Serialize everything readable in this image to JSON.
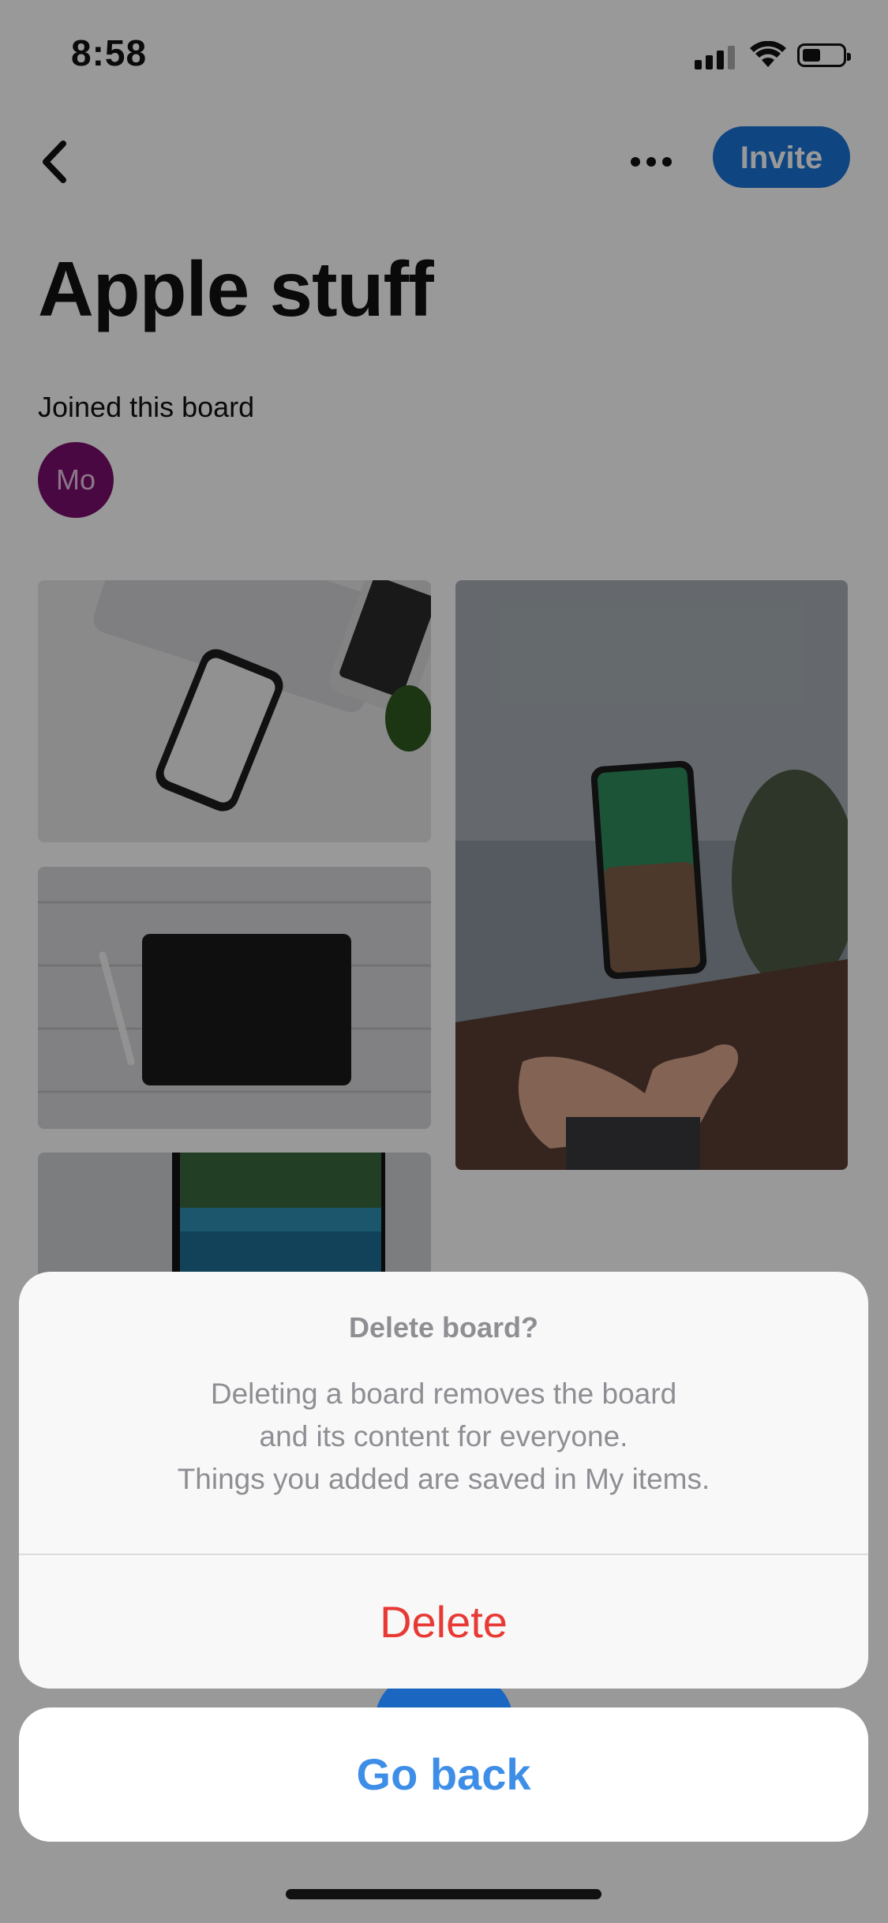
{
  "status_bar": {
    "time": "8:58"
  },
  "nav": {
    "invite_label": "Invite"
  },
  "board": {
    "title": "Apple stuff",
    "joined_label": "Joined this board",
    "member_initials": "Mo"
  },
  "dialog": {
    "title": "Delete board?",
    "message_lines": [
      "Deleting a board removes the board",
      "and its content for everyone.",
      "Things you added are saved in My items."
    ],
    "delete_label": "Delete",
    "cancel_label": "Go back"
  },
  "colors": {
    "accent": "#1a73d6",
    "destructive": "#e83a35",
    "link": "#3e8ee8",
    "avatar": "#7a0e6e"
  },
  "icons": [
    "back-chevron-icon",
    "more-dots-icon",
    "signal-icon",
    "wifi-icon",
    "battery-icon"
  ]
}
